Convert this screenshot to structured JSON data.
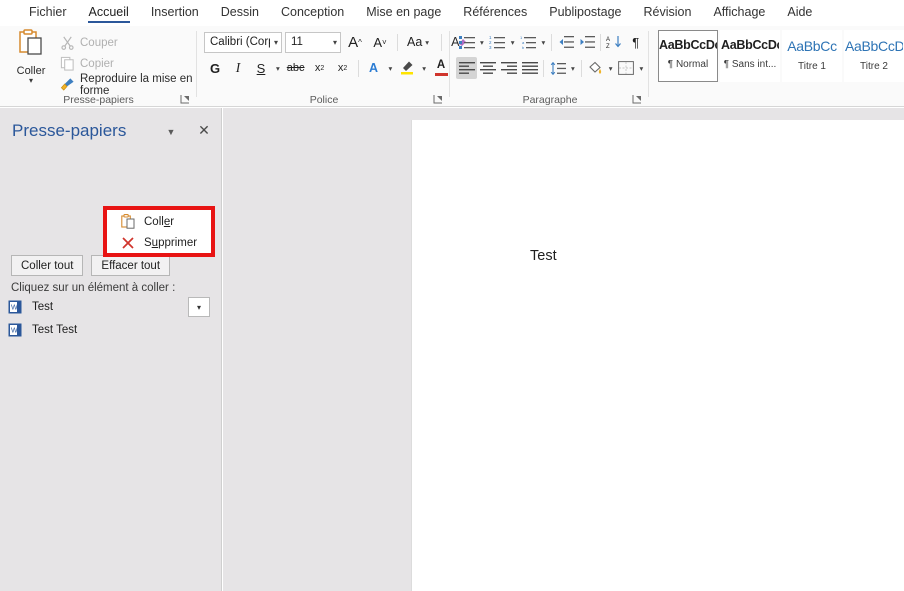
{
  "ribbon": {
    "tabs": [
      {
        "label": "Fichier",
        "active": false
      },
      {
        "label": "Accueil",
        "active": true
      },
      {
        "label": "Insertion",
        "active": false
      },
      {
        "label": "Dessin",
        "active": false
      },
      {
        "label": "Conception",
        "active": false
      },
      {
        "label": "Mise en page",
        "active": false
      },
      {
        "label": "Références",
        "active": false
      },
      {
        "label": "Publipostage",
        "active": false
      },
      {
        "label": "Révision",
        "active": false
      },
      {
        "label": "Affichage",
        "active": false
      },
      {
        "label": "Aide",
        "active": false
      }
    ],
    "clipboard_group": {
      "label": "Presse-papiers",
      "paste_label": "Coller",
      "cut_label": "Couper",
      "copy_label": "Copier",
      "format_painter_label": "Reproduire la mise en forme"
    },
    "font_group": {
      "label": "Police",
      "font_name": "Calibri (Corps)",
      "font_size": "11",
      "grow_font": "A",
      "shrink_font": "A",
      "change_case": "Aa",
      "clear_formatting": "A",
      "bold": "G",
      "italic": "I",
      "underline": "S",
      "strikethrough": "abc",
      "subscript": "x",
      "superscript": "x",
      "text_effects": "A",
      "highlight": "A",
      "font_color": "A"
    },
    "paragraph_group": {
      "label": "Paragraphe"
    },
    "styles_group": {
      "items": [
        {
          "preview": "AaBbCcDc",
          "name": "¶ Normal",
          "heading": false,
          "selected": true
        },
        {
          "preview": "AaBbCcDc",
          "name": "¶ Sans int...",
          "heading": false,
          "selected": false
        },
        {
          "preview": "AaBbCc",
          "name": "Titre 1",
          "heading": true,
          "selected": false
        },
        {
          "preview": "AaBbCcD",
          "name": "Titre 2",
          "heading": true,
          "selected": false
        }
      ]
    }
  },
  "clipboard_pane": {
    "title": "Presse-papiers",
    "paste_all_label": "Coller tout",
    "clear_all_label": "Effacer tout",
    "hint": "Cliquez sur un élément à coller :",
    "items": [
      {
        "text": "Test"
      },
      {
        "text": "Test Test"
      }
    ],
    "context_menu": {
      "paste_label": "Coller",
      "delete_label": "Supprimer"
    }
  },
  "document": {
    "body_text": "Test"
  },
  "colors": {
    "accent": "#2b579a",
    "highlight_box": "#e81313",
    "pane_bg": "#e6e4e6",
    "heading_blue": "#2e74b5"
  }
}
